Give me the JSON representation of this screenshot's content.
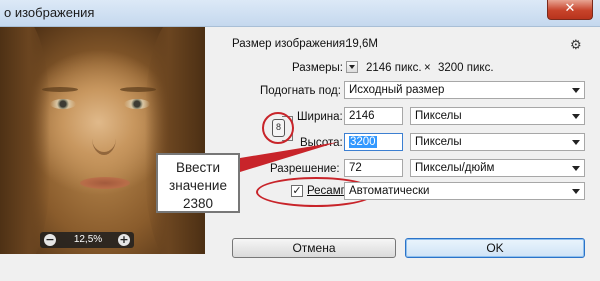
{
  "window": {
    "title": "о изображения",
    "close_glyph": "✕"
  },
  "preview": {
    "zoom": "12,5%",
    "zoom_out_glyph": "−",
    "zoom_in_glyph": "+"
  },
  "info": {
    "size_label": "Размер изображения:",
    "size_value": "19,6М",
    "dims_label": "Размеры:",
    "dims_width": "2146 пикс.",
    "dims_x": "×",
    "dims_height": "3200 пикс."
  },
  "fit": {
    "label": "Подогнать под:",
    "value": "Исходный размер"
  },
  "width": {
    "label": "Ширина:",
    "value": "2146",
    "unit": "Пикселы"
  },
  "height": {
    "label": "Высота:",
    "value": "3200",
    "unit": "Пикселы"
  },
  "resolution": {
    "label": "Разрешение:",
    "value": "72",
    "unit": "Пикселы/дюйм"
  },
  "resample": {
    "label": "Ресамплинг",
    "checked_glyph": "✓",
    "method": "Автоматически"
  },
  "callout": {
    "line1": "Ввести",
    "line2": "значение",
    "line3": "2380"
  },
  "buttons": {
    "cancel": "Отмена",
    "ok": "OK"
  },
  "icons": {
    "gear": "gear-icon",
    "link": "chain-link-icon"
  },
  "colors": {
    "annotation_red": "#c8242a",
    "selection_blue": "#3399ff"
  }
}
